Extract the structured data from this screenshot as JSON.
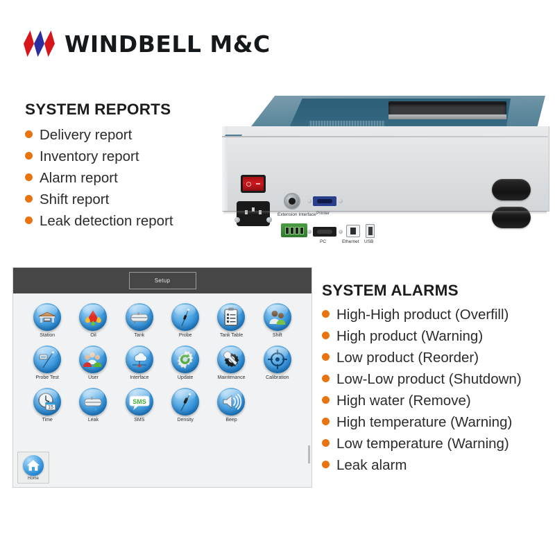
{
  "brand": {
    "logo_text": "WINDBELL M&C",
    "diamond_colors": [
      "#d5161b",
      "#2b2e9e",
      "#d5161b"
    ]
  },
  "colors": {
    "bullet_orange": "#e8730f",
    "heading_black": "#1c1c1c",
    "console_header": "#464646",
    "icon_blue": "#1f7fc9"
  },
  "reports": {
    "title": "SYSTEM REPORTS",
    "items": [
      "Delivery report",
      "Inventory report",
      "Alarm report",
      "Shift report",
      "Leak detection report"
    ]
  },
  "alarms": {
    "title": "SYSTEM ALARMS",
    "items": [
      "High-High product (Overfill)",
      "High product (Warning)",
      "Low product (Reorder)",
      "Low-Low product (Shutdown)",
      "High water (Remove)",
      "High temperature (Warning)",
      "Low temperature (Warning)",
      "Leak alarm"
    ]
  },
  "device": {
    "port_labels": [
      "Extension Interface",
      "Printer",
      "PC",
      "Ethernet",
      "USB"
    ]
  },
  "console": {
    "title": "Setup",
    "home_label": "Home",
    "icons": [
      {
        "label": "Station",
        "icon": "station-icon"
      },
      {
        "label": "Oil",
        "icon": "oil-drop-icon"
      },
      {
        "label": "Tank",
        "icon": "tank-icon"
      },
      {
        "label": "Probe",
        "icon": "probe-icon"
      },
      {
        "label": "Tank Table",
        "icon": "clipboard-icon"
      },
      {
        "label": "Shift",
        "icon": "users-shift-icon"
      },
      {
        "label": "Probe Test",
        "icon": "probe-test-icon"
      },
      {
        "label": "User",
        "icon": "users-icon"
      },
      {
        "label": "Interface",
        "icon": "cloud-network-icon"
      },
      {
        "label": "Update",
        "icon": "update-gear-icon"
      },
      {
        "label": "Maintenance",
        "icon": "gear-wrench-icon"
      },
      {
        "label": "Calibration",
        "icon": "crosshair-icon"
      },
      {
        "label": "Time",
        "icon": "clock-calendar-icon"
      },
      {
        "label": "Leak",
        "icon": "leak-tank-icon"
      },
      {
        "label": "SMS",
        "icon": "sms-bubble-icon"
      },
      {
        "label": "Density",
        "icon": "density-probe-icon"
      },
      {
        "label": "Beep",
        "icon": "speaker-icon"
      }
    ]
  }
}
